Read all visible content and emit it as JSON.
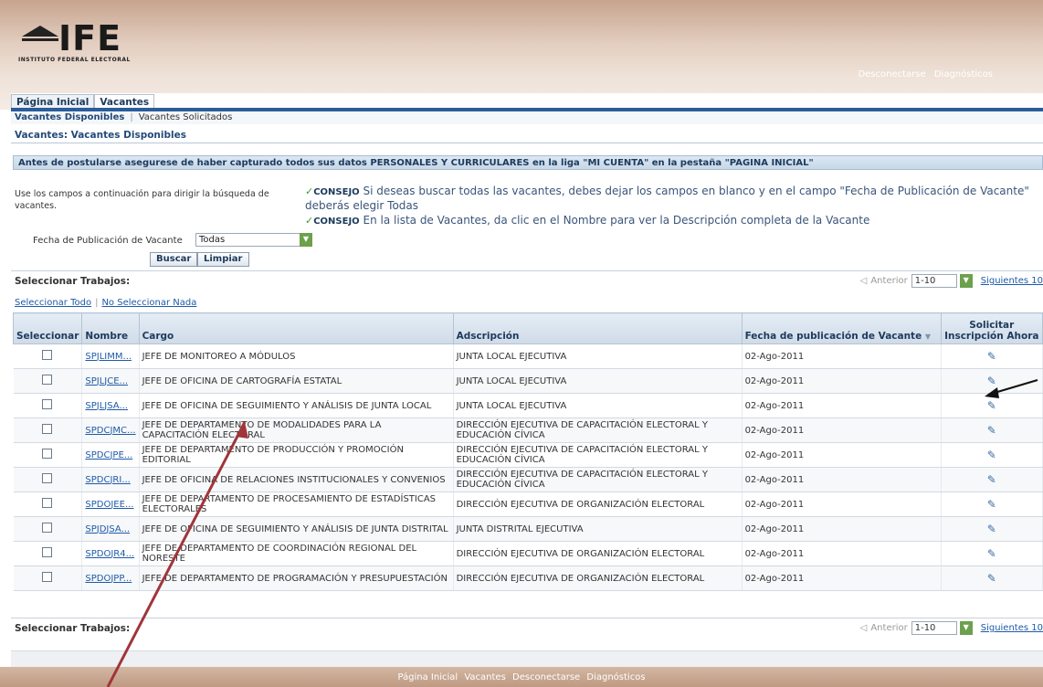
{
  "logo": {
    "name": "IFE",
    "subtitle": "INSTITUTO FEDERAL ELECTORAL"
  },
  "global_links": [
    "Desconectarse",
    "Diagnósticos"
  ],
  "tabs": [
    {
      "label": "Página Inicial",
      "active": false
    },
    {
      "label": "Vacantes",
      "active": true
    }
  ],
  "subtabs": {
    "selected": "Vacantes Disponibles",
    "other": "Vacantes Solicitados"
  },
  "breadcrumb": "Vacantes: Vacantes Disponibles",
  "notice": "Antes de postularse asegurese de haber capturado todos sus datos PERSONALES Y CURRICULARES en la liga \"MI CUENTA\" en la pestaña \"PAGINA INICIAL\"",
  "intro": "Use los campos a continuación para dirigir la búsqueda de vacantes.",
  "tips": [
    {
      "label": "CONSEJO",
      "text": "Si deseas buscar todas las vacantes, debes dejar los campos en blanco y en el campo \"Fecha de Publicación de Vacante\" deberás elegir Todas"
    },
    {
      "label": "CONSEJO",
      "text": "En la lista de Vacantes, da clic en el Nombre para ver la Descripción completa de la Vacante"
    }
  ],
  "filter": {
    "label": "Fecha de Publicación de Vacante",
    "value": "Todas"
  },
  "buttons": {
    "search": "Buscar",
    "clear": "Limpiar"
  },
  "section_title": "Seleccionar Trabajos:",
  "pager": {
    "prev": "Anterior",
    "range": "1-10",
    "next": "Siguientes 10"
  },
  "select_links": {
    "all": "Seleccionar Todo",
    "none": "No Seleccionar Nada"
  },
  "columns": {
    "select": "Seleccionar",
    "name": "Nombre",
    "cargo": "Cargo",
    "adscripcion": "Adscripción",
    "fecha": "Fecha de publicación de Vacante",
    "solicitar": "Solicitar Inscripción Ahora"
  },
  "rows": [
    {
      "name": "SPJLIMM...",
      "cargo": "JEFE DE MONITOREO A MÓDULOS",
      "adscripcion": "JUNTA LOCAL EJECUTIVA",
      "fecha": "02-Ago-2011"
    },
    {
      "name": "SPJLJCE...",
      "cargo": "JEFE DE OFICINA DE CARTOGRAFÍA ESTATAL",
      "adscripcion": "JUNTA LOCAL EJECUTIVA",
      "fecha": "02-Ago-2011"
    },
    {
      "name": "SPJLJSA...",
      "cargo": "JEFE DE OFICINA DE SEGUIMIENTO Y ANÁLISIS DE JUNTA LOCAL",
      "adscripcion": "JUNTA LOCAL EJECUTIVA",
      "fecha": "02-Ago-2011"
    },
    {
      "name": "SPDCJMC...",
      "cargo": "JEFE DE DEPARTAMENTO DE MODALIDADES PARA LA CAPACITACIÓN ELECTORAL",
      "adscripcion": "DIRECCIÓN EJECUTIVA DE CAPACITACIÓN ELECTORAL Y EDUCACIÓN CÍVICA",
      "fecha": "02-Ago-2011"
    },
    {
      "name": "SPDCJPE...",
      "cargo": "JEFE DE DEPARTAMENTO DE PRODUCCIÓN Y PROMOCIÓN EDITORIAL",
      "adscripcion": "DIRECCIÓN EJECUTIVA DE CAPACITACIÓN ELECTORAL Y EDUCACIÓN CÍVICA",
      "fecha": "02-Ago-2011"
    },
    {
      "name": "SPDCJRI...",
      "cargo": "JEFE DE OFICINA DE RELACIONES INSTITUCIONALES Y CONVENIOS",
      "adscripcion": "DIRECCIÓN EJECUTIVA DE CAPACITACIÓN ELECTORAL Y EDUCACIÓN CÍVICA",
      "fecha": "02-Ago-2011"
    },
    {
      "name": "SPDOJEE...",
      "cargo": "JEFE DE DEPARTAMENTO DE PROCESAMIENTO DE ESTADÍSTICAS ELECTORALES",
      "adscripcion": "DIRECCIÓN EJECUTIVA DE ORGANIZACIÓN ELECTORAL",
      "fecha": "02-Ago-2011"
    },
    {
      "name": "SPJDJSA...",
      "cargo": "JEFE DE OFICINA DE SEGUIMIENTO Y ANÁLISIS DE JUNTA DISTRITAL",
      "adscripcion": "JUNTA DISTRITAL EJECUTIVA",
      "fecha": "02-Ago-2011"
    },
    {
      "name": "SPDOJR4...",
      "cargo": "JEFE DE DEPARTAMENTO DE COORDINACIÓN REGIONAL DEL NORESTE",
      "adscripcion": "DIRECCIÓN EJECUTIVA DE ORGANIZACIÓN ELECTORAL",
      "fecha": "02-Ago-2011"
    },
    {
      "name": "SPDOJPP...",
      "cargo": "JEFE DE DEPARTAMENTO DE PROGRAMACIÓN Y PRESUPUESTACIÓN",
      "adscripcion": "DIRECCIÓN EJECUTIVA DE ORGANIZACIÓN ELECTORAL",
      "fecha": "02-Ago-2011"
    }
  ],
  "footer_links": [
    "Página Inicial",
    "Vacantes",
    "Desconectarse",
    "Diagnósticos"
  ],
  "annotation_color": "#a0353a"
}
